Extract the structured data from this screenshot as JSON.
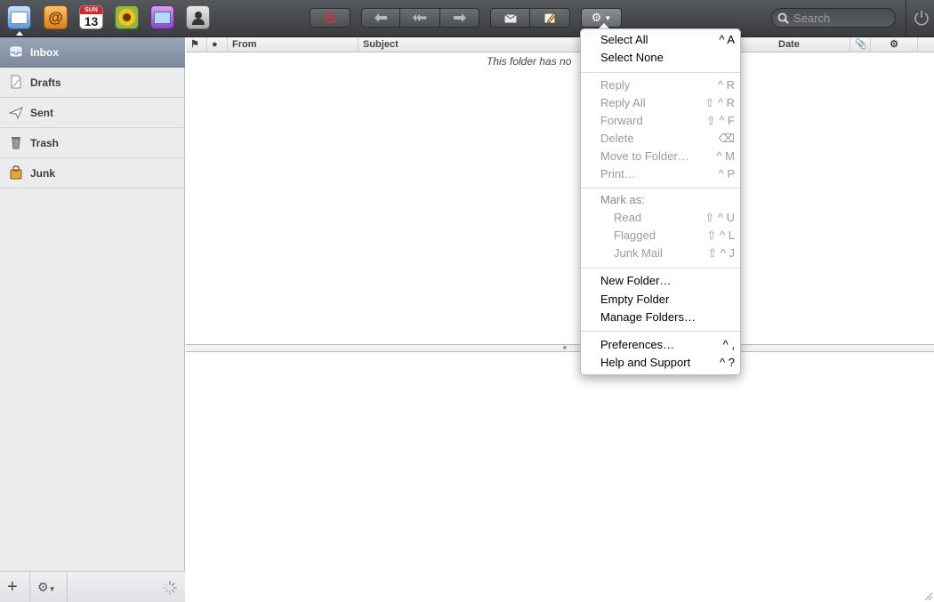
{
  "dock": {
    "calendar_day": "SUN",
    "calendar_date": "13"
  },
  "toolbar": {
    "actions_icon": "gear-icon"
  },
  "search": {
    "placeholder": "Search"
  },
  "sidebar": {
    "folders": [
      {
        "label": "Inbox",
        "icon": "inbox-icon",
        "selected": true
      },
      {
        "label": "Drafts",
        "icon": "drafts-icon"
      },
      {
        "label": "Sent",
        "icon": "sent-icon"
      },
      {
        "label": "Trash",
        "icon": "trash-icon"
      },
      {
        "label": "Junk",
        "icon": "junk-icon"
      }
    ],
    "footer": {
      "add": "+"
    }
  },
  "message_list": {
    "columns": {
      "from": "From",
      "subject": "Subject",
      "date": "Date"
    },
    "empty_text": "This folder has no"
  },
  "menu": {
    "select_all": {
      "label": "Select All",
      "shortcut": "^ A"
    },
    "select_none": {
      "label": "Select None"
    },
    "reply": {
      "label": "Reply",
      "shortcut": "^ R"
    },
    "reply_all": {
      "label": "Reply All",
      "shortcut": "⇧ ^ R"
    },
    "forward": {
      "label": "Forward",
      "shortcut": "⇧ ^ F"
    },
    "delete": {
      "label": "Delete",
      "shortcut": "⌫"
    },
    "move_to_folder": {
      "label": "Move to Folder…",
      "shortcut": "^ M"
    },
    "print": {
      "label": "Print…",
      "shortcut": "^ P"
    },
    "mark_as": {
      "label": "Mark as:"
    },
    "read": {
      "label": "Read",
      "shortcut": "⇧ ^ U"
    },
    "flagged": {
      "label": "Flagged",
      "shortcut": "⇧ ^ L"
    },
    "junk_mail": {
      "label": "Junk Mail",
      "shortcut": "⇧ ^ J"
    },
    "new_folder": {
      "label": "New Folder…"
    },
    "empty_folder": {
      "label": "Empty Folder"
    },
    "manage_folders": {
      "label": "Manage Folders…"
    },
    "preferences": {
      "label": "Preferences…",
      "shortcut": "^ ,"
    },
    "help": {
      "label": "Help and Support",
      "shortcut": "^ ?"
    }
  }
}
